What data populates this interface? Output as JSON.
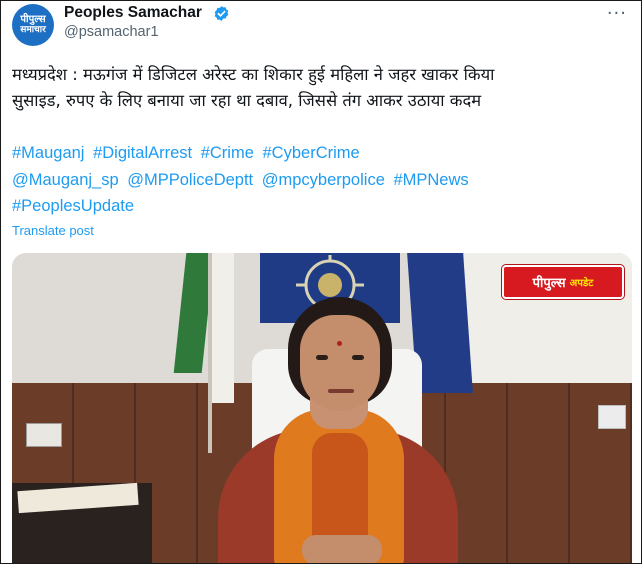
{
  "account": {
    "avatar_line1": "पीपुल्स",
    "avatar_line2": "समाचार",
    "display_name": "Peoples Samachar",
    "handle": "@psamachar1",
    "more_label": "···"
  },
  "post": {
    "text_line1": "मध्यप्रदेश : मऊगंज में डिजिटल अरेस्ट का शिकार हुई महिला ने जहर खाकर किया",
    "text_line2": "सुसाइड, रुपए के लिए बनाया जा रहा था दबाव, जिससे तंग आकर उठाया कदम",
    "tags": [
      "#Mauganj",
      "#DigitalArrest",
      "#Crime",
      "#CyberCrime",
      "@Mauganj_sp",
      "@MPPoliceDeptt",
      "@mpcyberpolice",
      "#MPNews",
      "#PeoplesUpdate"
    ],
    "translate_label": "Translate post"
  },
  "media": {
    "logo_part1": "पीपुल्स",
    "logo_part2": "अपडेट"
  },
  "colors": {
    "link": "#1d9bf0",
    "verified": "#1d9bf0",
    "logo_bg": "#d71920"
  }
}
